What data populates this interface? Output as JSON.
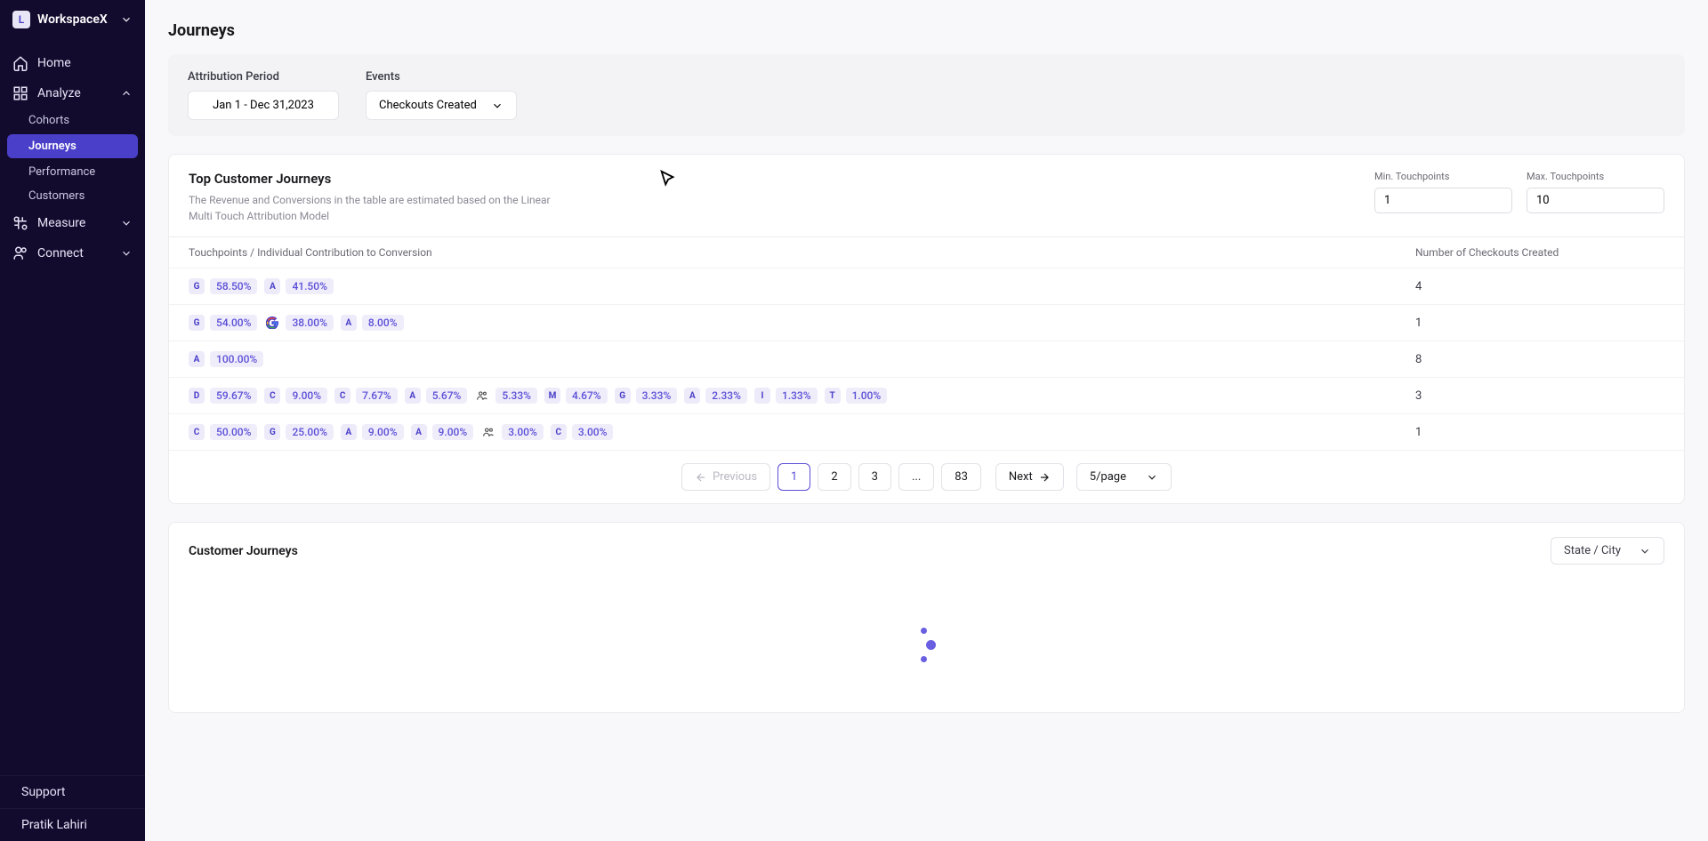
{
  "workspace": {
    "badge": "L",
    "name": "WorkspaceX"
  },
  "nav": {
    "home": "Home",
    "analyze": "Analyze",
    "analyze_sub": {
      "cohorts": "Cohorts",
      "journeys": "Journeys",
      "performance": "Performance",
      "customers": "Customers"
    },
    "measure": "Measure",
    "connect": "Connect"
  },
  "footer": {
    "support": "Support",
    "user": "Pratik Lahiri"
  },
  "page": {
    "title": "Journeys"
  },
  "filters": {
    "period_label": "Attribution Period",
    "period_value": "Jan 1 - Dec 31,2023",
    "events_label": "Events",
    "events_value": "Checkouts Created"
  },
  "journeys_card": {
    "title": "Top Customer Journeys",
    "desc": "The Revenue and Conversions in the table are estimated based on the Linear Multi Touch Attribution Model",
    "min_label": "Min. Touchpoints",
    "min_value": "1",
    "max_label": "Max. Touchpoints",
    "max_value": "10",
    "col_left": "Touchpoints / Individual Contribution to Conversion",
    "col_right": "Number of Checkouts Created",
    "rows": [
      {
        "count": "4",
        "tps": [
          {
            "i": "G",
            "p": "58.50%"
          },
          {
            "i": "A",
            "p": "41.50%"
          }
        ]
      },
      {
        "count": "1",
        "tps": [
          {
            "i": "G",
            "p": "54.00%"
          },
          {
            "i": "GOOGLE",
            "p": "38.00%"
          },
          {
            "i": "A",
            "p": "8.00%"
          }
        ]
      },
      {
        "count": "8",
        "tps": [
          {
            "i": "A",
            "p": "100.00%"
          }
        ]
      },
      {
        "count": "3",
        "tps": [
          {
            "i": "D",
            "p": "59.67%"
          },
          {
            "i": "C",
            "p": "9.00%"
          },
          {
            "i": "C",
            "p": "7.67%"
          },
          {
            "i": "A",
            "p": "5.67%"
          },
          {
            "i": "PEOPLE",
            "p": "5.33%"
          },
          {
            "i": "M",
            "p": "4.67%"
          },
          {
            "i": "G",
            "p": "3.33%"
          },
          {
            "i": "A",
            "p": "2.33%"
          },
          {
            "i": "I",
            "p": "1.33%"
          },
          {
            "i": "T",
            "p": "1.00%"
          }
        ]
      },
      {
        "count": "1",
        "tps": [
          {
            "i": "C",
            "p": "50.00%"
          },
          {
            "i": "G",
            "p": "25.00%"
          },
          {
            "i": "A",
            "p": "9.00%"
          },
          {
            "i": "A",
            "p": "9.00%"
          },
          {
            "i": "PEOPLE",
            "p": "3.00%"
          },
          {
            "i": "C",
            "p": "3.00%"
          }
        ]
      }
    ]
  },
  "pagination": {
    "prev": "Previous",
    "pages": [
      "1",
      "2",
      "3",
      "...",
      "83"
    ],
    "next": "Next",
    "size": "5/page"
  },
  "lower_card": {
    "title": "Customer Journeys",
    "location": "State / City"
  }
}
